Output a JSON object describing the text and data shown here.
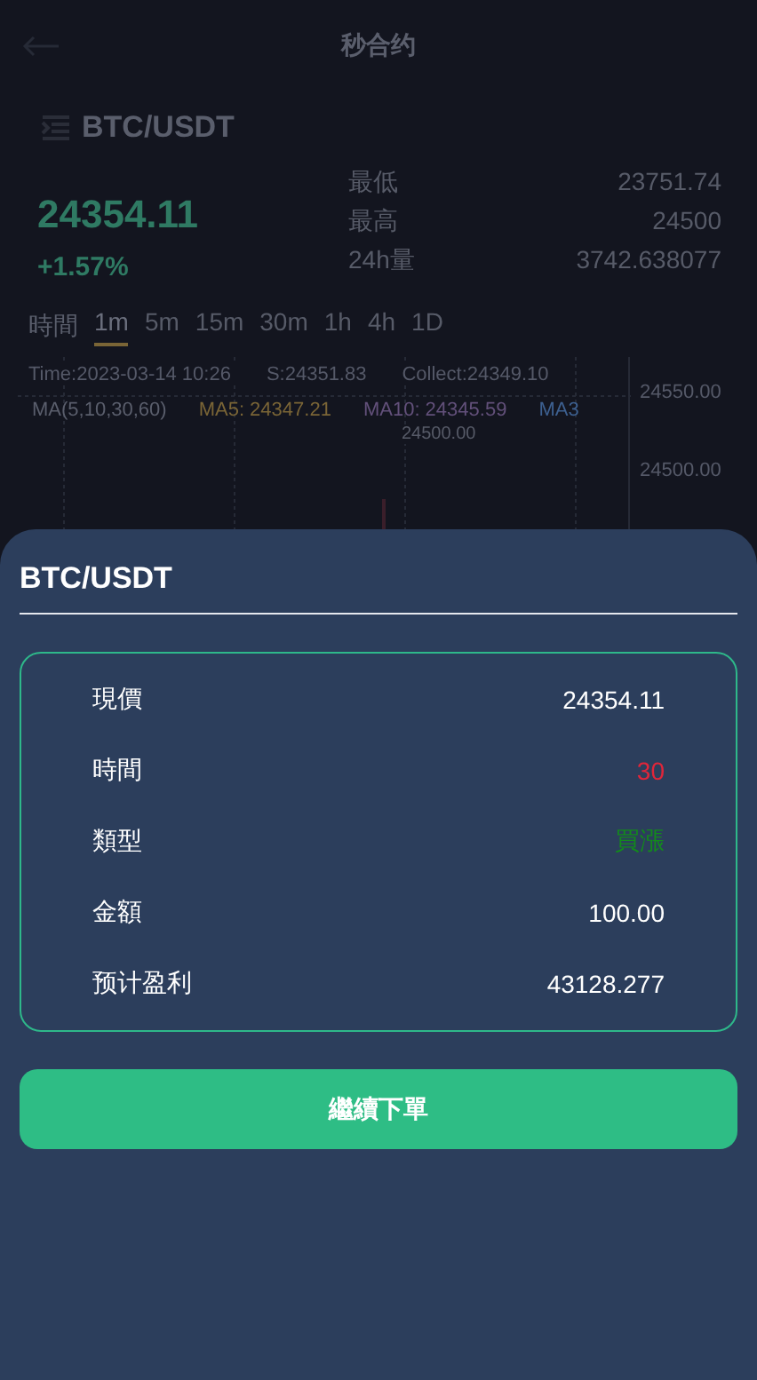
{
  "header": {
    "title": "秒合约"
  },
  "market": {
    "pair": "BTC/USDT",
    "price": "24354.11",
    "change": "+1.57%",
    "stats": [
      {
        "label": "最低",
        "value": "23751.74"
      },
      {
        "label": "最高",
        "value": "24500"
      },
      {
        "label": "24h量",
        "value": "3742.638077"
      }
    ]
  },
  "interval_label": "時間",
  "intervals": [
    {
      "label": "1m",
      "selected": true
    },
    {
      "label": "5m",
      "selected": false
    },
    {
      "label": "15m",
      "selected": false
    },
    {
      "label": "30m",
      "selected": false
    },
    {
      "label": "1h",
      "selected": false
    },
    {
      "label": "4h",
      "selected": false
    },
    {
      "label": "1D",
      "selected": false
    }
  ],
  "chart": {
    "info": [
      "Time:2023-03-14 10:26",
      "S:24351.83",
      "Collect:24349.10"
    ],
    "ma": [
      {
        "label": "MA(5,10,30,60)",
        "color": "#5a5e6c"
      },
      {
        "label": "MA5: 24347.21",
        "color": "#7a6536"
      },
      {
        "label": "MA10: 24345.59",
        "color": "#62507a"
      },
      {
        "label": "MA3",
        "color": "#3d6090"
      }
    ],
    "high_label": "24500.00",
    "axis_labels": [
      "24550.00",
      "24500.00"
    ]
  },
  "sheet": {
    "title": "BTC/USDT",
    "rows": [
      {
        "label": "現價",
        "value": "24354.11"
      },
      {
        "label": "時間",
        "value": "30",
        "color": "#e0263a"
      },
      {
        "label": "類型",
        "value": "買漲",
        "color": "#138a1c"
      },
      {
        "label": "金額",
        "value": "100.00"
      },
      {
        "label": "预计盈利",
        "value": "43128.277"
      }
    ],
    "button": "繼續下單"
  }
}
